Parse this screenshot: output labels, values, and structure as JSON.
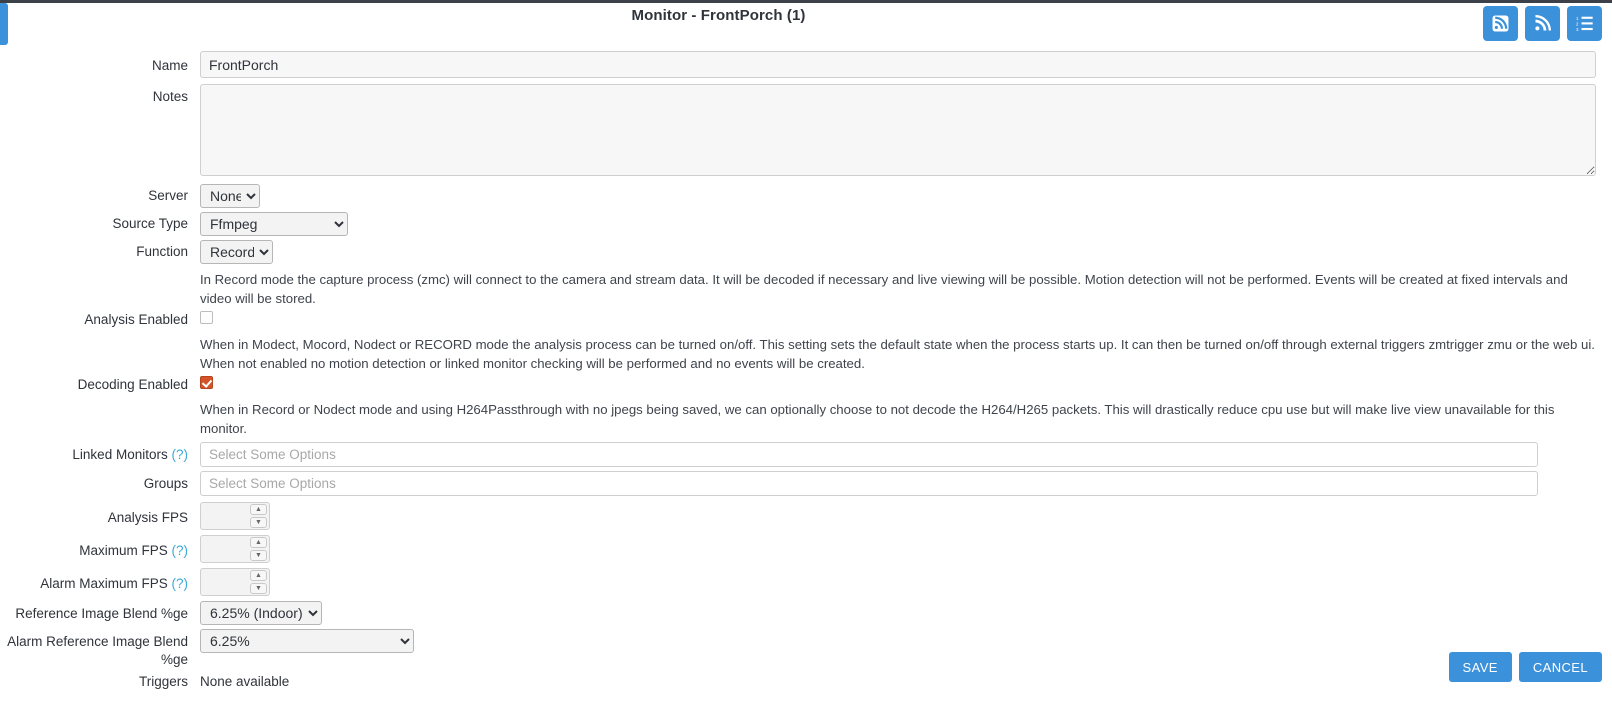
{
  "header": {
    "title": "Monitor - FrontPorch (1)",
    "buttons": [
      {
        "name": "rss-square-icon",
        "label": ""
      },
      {
        "name": "rss-icon",
        "label": ""
      },
      {
        "name": "list-ol-icon",
        "label": ""
      }
    ]
  },
  "form": {
    "name": {
      "label": "Name",
      "value": "FrontPorch"
    },
    "notes": {
      "label": "Notes",
      "value": ""
    },
    "server": {
      "label": "Server",
      "value": "None",
      "options": [
        "None"
      ]
    },
    "source_type": {
      "label": "Source Type",
      "value": "Ffmpeg",
      "options": [
        "Ffmpeg"
      ]
    },
    "function": {
      "label": "Function",
      "value": "Record",
      "options": [
        "Record"
      ]
    },
    "function_desc": "In Record mode the capture process (zmc) will connect to the camera and stream data. It will be decoded if necessary and live viewing will be possible. Motion detection will not be performed. Events will be created at fixed intervals and video will be stored.",
    "analysis_enabled": {
      "label": "Analysis Enabled",
      "checked": false
    },
    "analysis_desc": "When in Modect, Mocord, Nodect or RECORD mode the analysis process can be turned on/off. This setting sets the default state when the process starts up. It can then be turned on/off through external triggers zmtrigger zmu or the web ui. When not enabled no motion detection or linked monitor checking will be performed and no events will be created.",
    "decoding_enabled": {
      "label": "Decoding Enabled",
      "checked": true
    },
    "decoding_desc": "When in Record or Nodect mode and using H264Passthrough with no jpegs being saved, we can optionally choose to not decode the H264/H265 packets. This will drastically reduce cpu use but will make live view unavailable for this monitor.",
    "linked_monitors": {
      "label": "Linked Monitors",
      "help": "(?)",
      "placeholder": "Select Some Options",
      "value": ""
    },
    "groups": {
      "label": "Groups",
      "placeholder": "Select Some Options",
      "value": ""
    },
    "analysis_fps": {
      "label": "Analysis FPS",
      "value": ""
    },
    "maximum_fps": {
      "label": "Maximum FPS",
      "help": "(?)",
      "value": ""
    },
    "alarm_maximum_fps": {
      "label": "Alarm Maximum FPS",
      "help": "(?)",
      "value": ""
    },
    "ref_blend": {
      "label": "Reference Image Blend %ge",
      "value": "6.25% (Indoor)",
      "options": [
        "6.25% (Indoor)"
      ]
    },
    "alarm_ref_blend": {
      "label": "Alarm Reference Image Blend %ge",
      "value": "6.25%",
      "options": [
        "6.25%"
      ]
    },
    "triggers": {
      "label": "Triggers",
      "value": "None available"
    }
  },
  "footer": {
    "save_label": "SAVE",
    "cancel_label": "CANCEL"
  },
  "colors": {
    "accent": "#3c91db",
    "checkbox_on": "#d4542a",
    "help_link": "#3ba9d6",
    "topbar": "#3c4049"
  }
}
